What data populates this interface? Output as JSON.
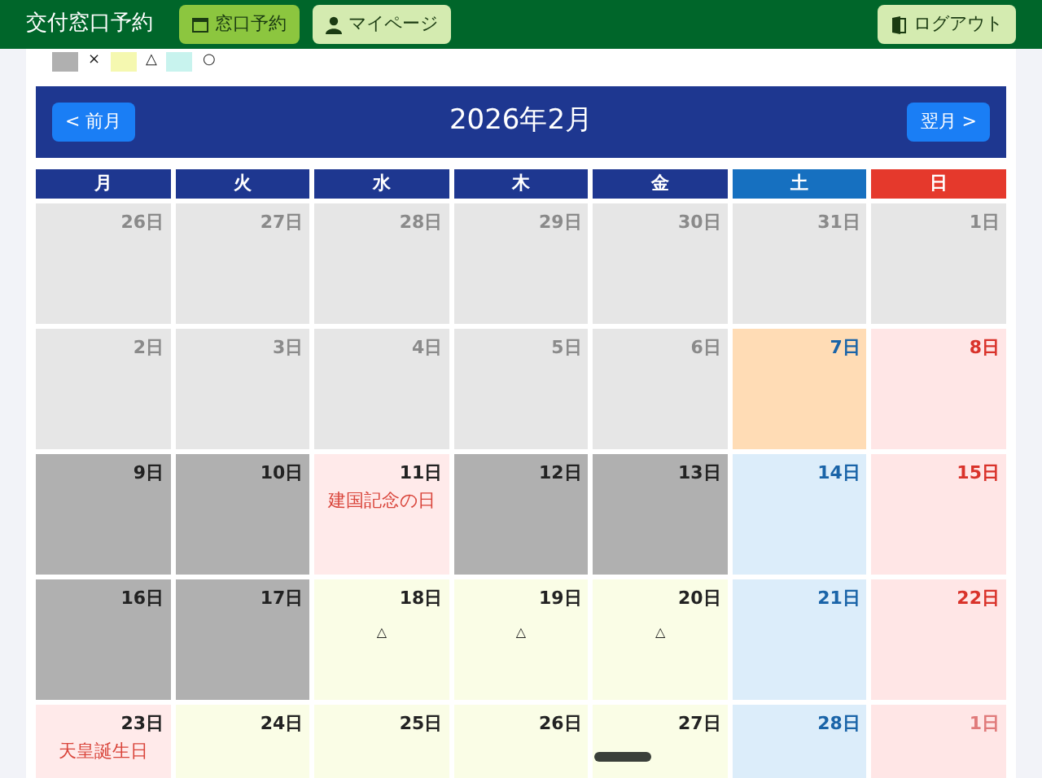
{
  "header": {
    "title": "交付窓口予約",
    "nav": [
      {
        "label": "窓口予約",
        "selected": true
      },
      {
        "label": "マイページ",
        "selected": false
      }
    ],
    "logout": "ログアウト"
  },
  "legend": [
    {
      "color": "#b0b0b0",
      "label": "×"
    },
    {
      "color": "#f5f8b0",
      "label": "△"
    },
    {
      "color": "#c8f3ee",
      "label": "○"
    }
  ],
  "calendar": {
    "title": "2026年2月",
    "prev": "< 前月",
    "next": "翌月 >",
    "weekdays": [
      {
        "label": "月",
        "kind": "weekday"
      },
      {
        "label": "火",
        "kind": "weekday"
      },
      {
        "label": "水",
        "kind": "weekday"
      },
      {
        "label": "木",
        "kind": "weekday"
      },
      {
        "label": "金",
        "kind": "weekday"
      },
      {
        "label": "土",
        "kind": "sat"
      },
      {
        "label": "日",
        "kind": "sun"
      }
    ],
    "days": [
      {
        "label": "26日",
        "kind": "past"
      },
      {
        "label": "27日",
        "kind": "past"
      },
      {
        "label": "28日",
        "kind": "past"
      },
      {
        "label": "29日",
        "kind": "past"
      },
      {
        "label": "30日",
        "kind": "past"
      },
      {
        "label": "31日",
        "kind": "past"
      },
      {
        "label": "1日",
        "kind": "past"
      },
      {
        "label": "2日",
        "kind": "past"
      },
      {
        "label": "3日",
        "kind": "past"
      },
      {
        "label": "4日",
        "kind": "past"
      },
      {
        "label": "5日",
        "kind": "past"
      },
      {
        "label": "6日",
        "kind": "past"
      },
      {
        "label": "7日",
        "kind": "today"
      },
      {
        "label": "8日",
        "kind": "sun"
      },
      {
        "label": "9日",
        "kind": "closed"
      },
      {
        "label": "10日",
        "kind": "closed"
      },
      {
        "label": "11日",
        "kind": "holiday",
        "note": "建国記念の日"
      },
      {
        "label": "12日",
        "kind": "closed"
      },
      {
        "label": "13日",
        "kind": "closed"
      },
      {
        "label": "14日",
        "kind": "sat"
      },
      {
        "label": "15日",
        "kind": "sun"
      },
      {
        "label": "16日",
        "kind": "closed"
      },
      {
        "label": "17日",
        "kind": "closed"
      },
      {
        "label": "18日",
        "kind": "few",
        "mark": "△"
      },
      {
        "label": "19日",
        "kind": "few",
        "mark": "△"
      },
      {
        "label": "20日",
        "kind": "few",
        "mark": "△"
      },
      {
        "label": "21日",
        "kind": "sat"
      },
      {
        "label": "22日",
        "kind": "sun"
      },
      {
        "label": "23日",
        "kind": "holiday",
        "note": "天皇誕生日"
      },
      {
        "label": "24日",
        "kind": "few"
      },
      {
        "label": "25日",
        "kind": "few"
      },
      {
        "label": "26日",
        "kind": "few"
      },
      {
        "label": "27日",
        "kind": "few"
      },
      {
        "label": "28日",
        "kind": "sat"
      },
      {
        "label": "1日",
        "kind": "next_month"
      }
    ]
  }
}
